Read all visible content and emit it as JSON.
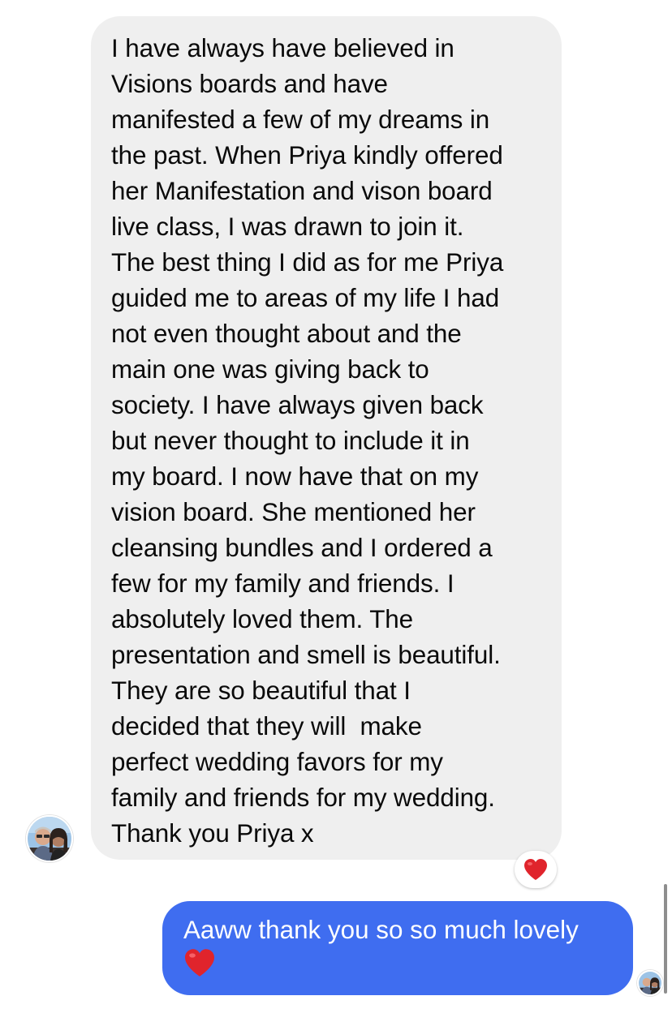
{
  "thread": {
    "incoming_message": {
      "lines": [
        "I have always have believed in",
        "Visions boards and have",
        "manifested a few of my dreams in",
        "the past. When Priya kindly offered",
        "her Manifestation and vison board",
        "live class, I was drawn to join it.",
        "The best thing I did as for me Priya",
        "guided me to areas of my life I had",
        "not even thought about and the",
        "main one was giving back to",
        "society. I have always given back",
        "but never thought to include it in",
        "my board. I now have that on my",
        "vision board. She mentioned her",
        "cleansing bundles and I ordered a",
        "few for my family and friends. I",
        "absolutely loved them. The",
        "presentation and smell is beautiful.",
        "They are so beautiful that I",
        "decided that they will  make",
        "perfect wedding favors for my",
        "family and friends for my wedding.",
        "Thank you Priya x"
      ],
      "bubble_color": "#efefef",
      "reaction": "heart",
      "avatar_icon": "contact-avatar"
    },
    "outgoing_message": {
      "text": "Aaww thank you so so much lovely",
      "trailing_emoji": "heart",
      "bubble_color": "#3f6df0",
      "avatar_icon": "read-receipt-avatar"
    },
    "heart_color": "#e0242c"
  }
}
